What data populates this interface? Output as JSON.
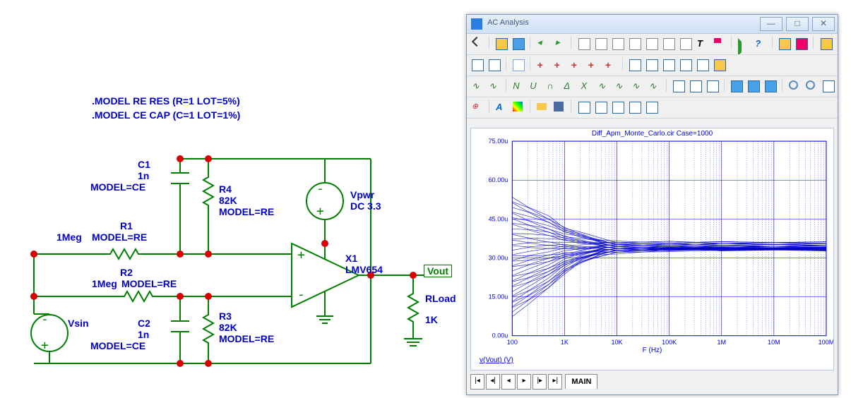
{
  "schematic": {
    "model_lines": [
      ".MODEL RE RES (R=1 LOT=5%)",
      ".MODEL CE CAP (C=1 LOT=1%)"
    ],
    "components": {
      "C1": {
        "name": "C1",
        "val": "1n",
        "model": "MODEL=CE"
      },
      "C2": {
        "name": "C2",
        "val": "1n",
        "model": "MODEL=CE"
      },
      "R1": {
        "name": "R1",
        "val": "1Meg",
        "model": "MODEL=RE"
      },
      "R2": {
        "name": "R2",
        "val": "1Meg",
        "model": "MODEL=RE"
      },
      "R3": {
        "name": "R3",
        "val": "82K",
        "model": "MODEL=RE"
      },
      "R4": {
        "name": "R4",
        "val": "82K",
        "model": "MODEL=RE"
      },
      "X1": {
        "name": "X1",
        "val": "LMV654"
      },
      "Vpwr": {
        "name": "Vpwr",
        "val": "DC 3.3"
      },
      "Vsin": {
        "name": "Vsin"
      },
      "RLoad": {
        "name": "RLoad",
        "val": "1K"
      },
      "Vout": "Vout"
    }
  },
  "window": {
    "title": "AC Analysis"
  },
  "status": {
    "tab": "MAIN"
  },
  "chart_data": {
    "type": "line",
    "title": "Diff_Apm_Monte_Carlo.cir Case=1000",
    "xlabel": "F (Hz)",
    "ylabel": "v(Vout) (V)",
    "x_scale": "log",
    "xlim": [
      100,
      100000000
    ],
    "ylim": [
      0,
      7.5e-05
    ],
    "x_ticks": [
      "100",
      "1K",
      "10K",
      "100K",
      "1M",
      "10M",
      "100M"
    ],
    "y_ticks": [
      "0.00u",
      "15.00u",
      "30.00u",
      "45.00u",
      "60.00u",
      "75.00u"
    ],
    "description": "Monte Carlo sweep of ~1000 cases; family of curves fanned at low F, converge ~34u at high F",
    "series_envelope": {
      "x": [
        100,
        200,
        500,
        1000,
        2000,
        5000,
        10000,
        100000,
        1000000,
        100000000
      ],
      "y_min_u": [
        8,
        12,
        18,
        24,
        28,
        31,
        32,
        33,
        33,
        33
      ],
      "y_median_u": [
        30,
        31,
        32,
        33,
        33,
        34,
        34,
        34,
        34,
        34
      ],
      "y_max_u": [
        53,
        50,
        46,
        42,
        40,
        37,
        36,
        36,
        36,
        36
      ]
    }
  }
}
